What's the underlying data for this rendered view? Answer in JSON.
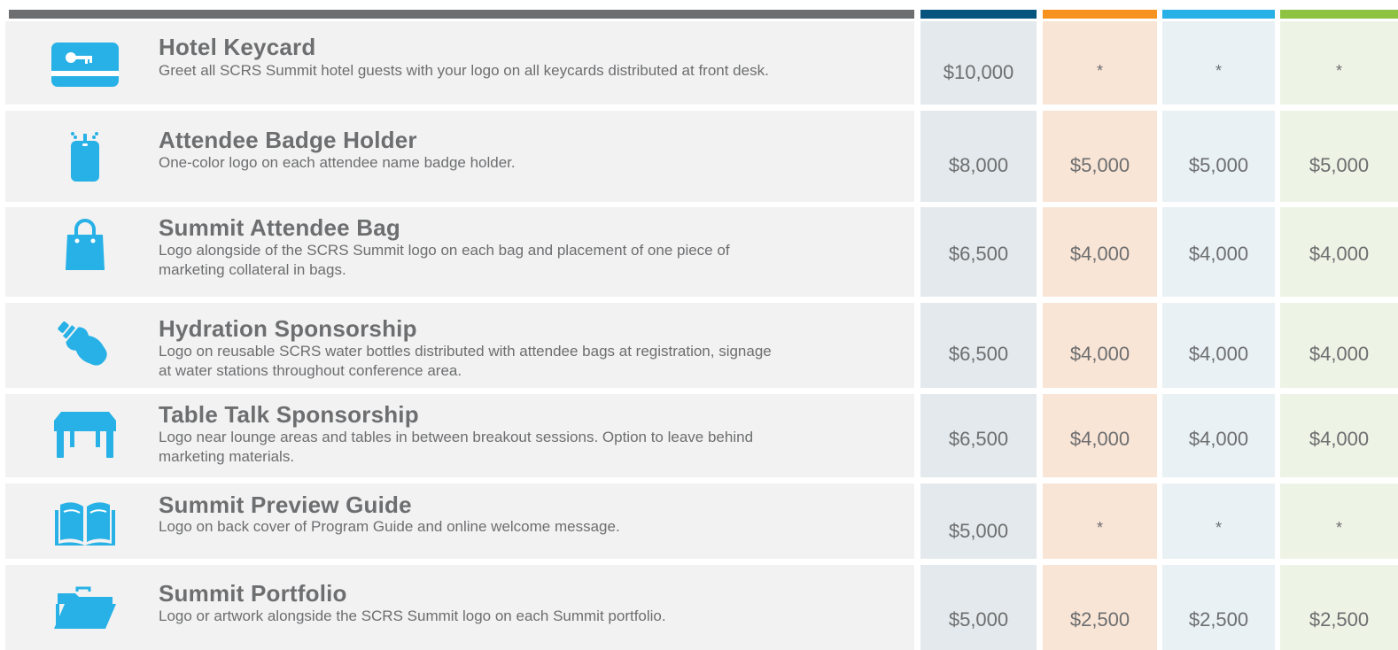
{
  "colors": {
    "header_gray": "#6d6e70",
    "col1": "#07547e",
    "col2": "#f7921e",
    "col3": "#27b1e6",
    "col4": "#8dc340",
    "icon_blue": "#27b1e6"
  },
  "rows": [
    {
      "icon": "keycard-icon",
      "title": "Hotel Keycard",
      "description": "Greet all SCRS Summit hotel guests with your logo on all keycards distributed at front desk.",
      "prices": [
        "$10,000",
        "*",
        "*",
        "*"
      ]
    },
    {
      "icon": "badge-holder-icon",
      "title": "Attendee Badge Holder",
      "description": "One-color logo on each attendee name badge holder.",
      "prices": [
        "$8,000",
        "$5,000",
        "$5,000",
        "$5,000"
      ]
    },
    {
      "icon": "shopping-bag-icon",
      "title": "Summit Attendee Bag",
      "description": "Logo alongside of the SCRS Summit logo on each bag and placement of one piece of marketing collateral in bags.",
      "prices": [
        "$6,500",
        "$4,000",
        "$4,000",
        "$4,000"
      ]
    },
    {
      "icon": "water-bottle-icon",
      "title": "Hydration Sponsorship",
      "description": "Logo on reusable SCRS water bottles distributed with attendee bags at registration, signage at water stations throughout conference area.",
      "prices": [
        "$6,500",
        "$4,000",
        "$4,000",
        "$4,000"
      ]
    },
    {
      "icon": "table-icon",
      "title": "Table Talk Sponsorship",
      "description": "Logo near lounge areas and tables in between breakout sessions. Option to leave behind marketing materials.",
      "prices": [
        "$6,500",
        "$4,000",
        "$4,000",
        "$4,000"
      ]
    },
    {
      "icon": "open-book-icon",
      "title": "Summit Preview Guide",
      "description": "Logo on back cover of Program Guide and online welcome message.",
      "prices": [
        "$5,000",
        "*",
        "*",
        "*"
      ]
    },
    {
      "icon": "folder-icon",
      "title": "Summit Portfolio",
      "description": "Logo or artwork alongside the SCRS Summit logo on each Summit portfolio.",
      "prices": [
        "$5,000",
        "$2,500",
        "$2,500",
        "$2,500"
      ]
    }
  ]
}
